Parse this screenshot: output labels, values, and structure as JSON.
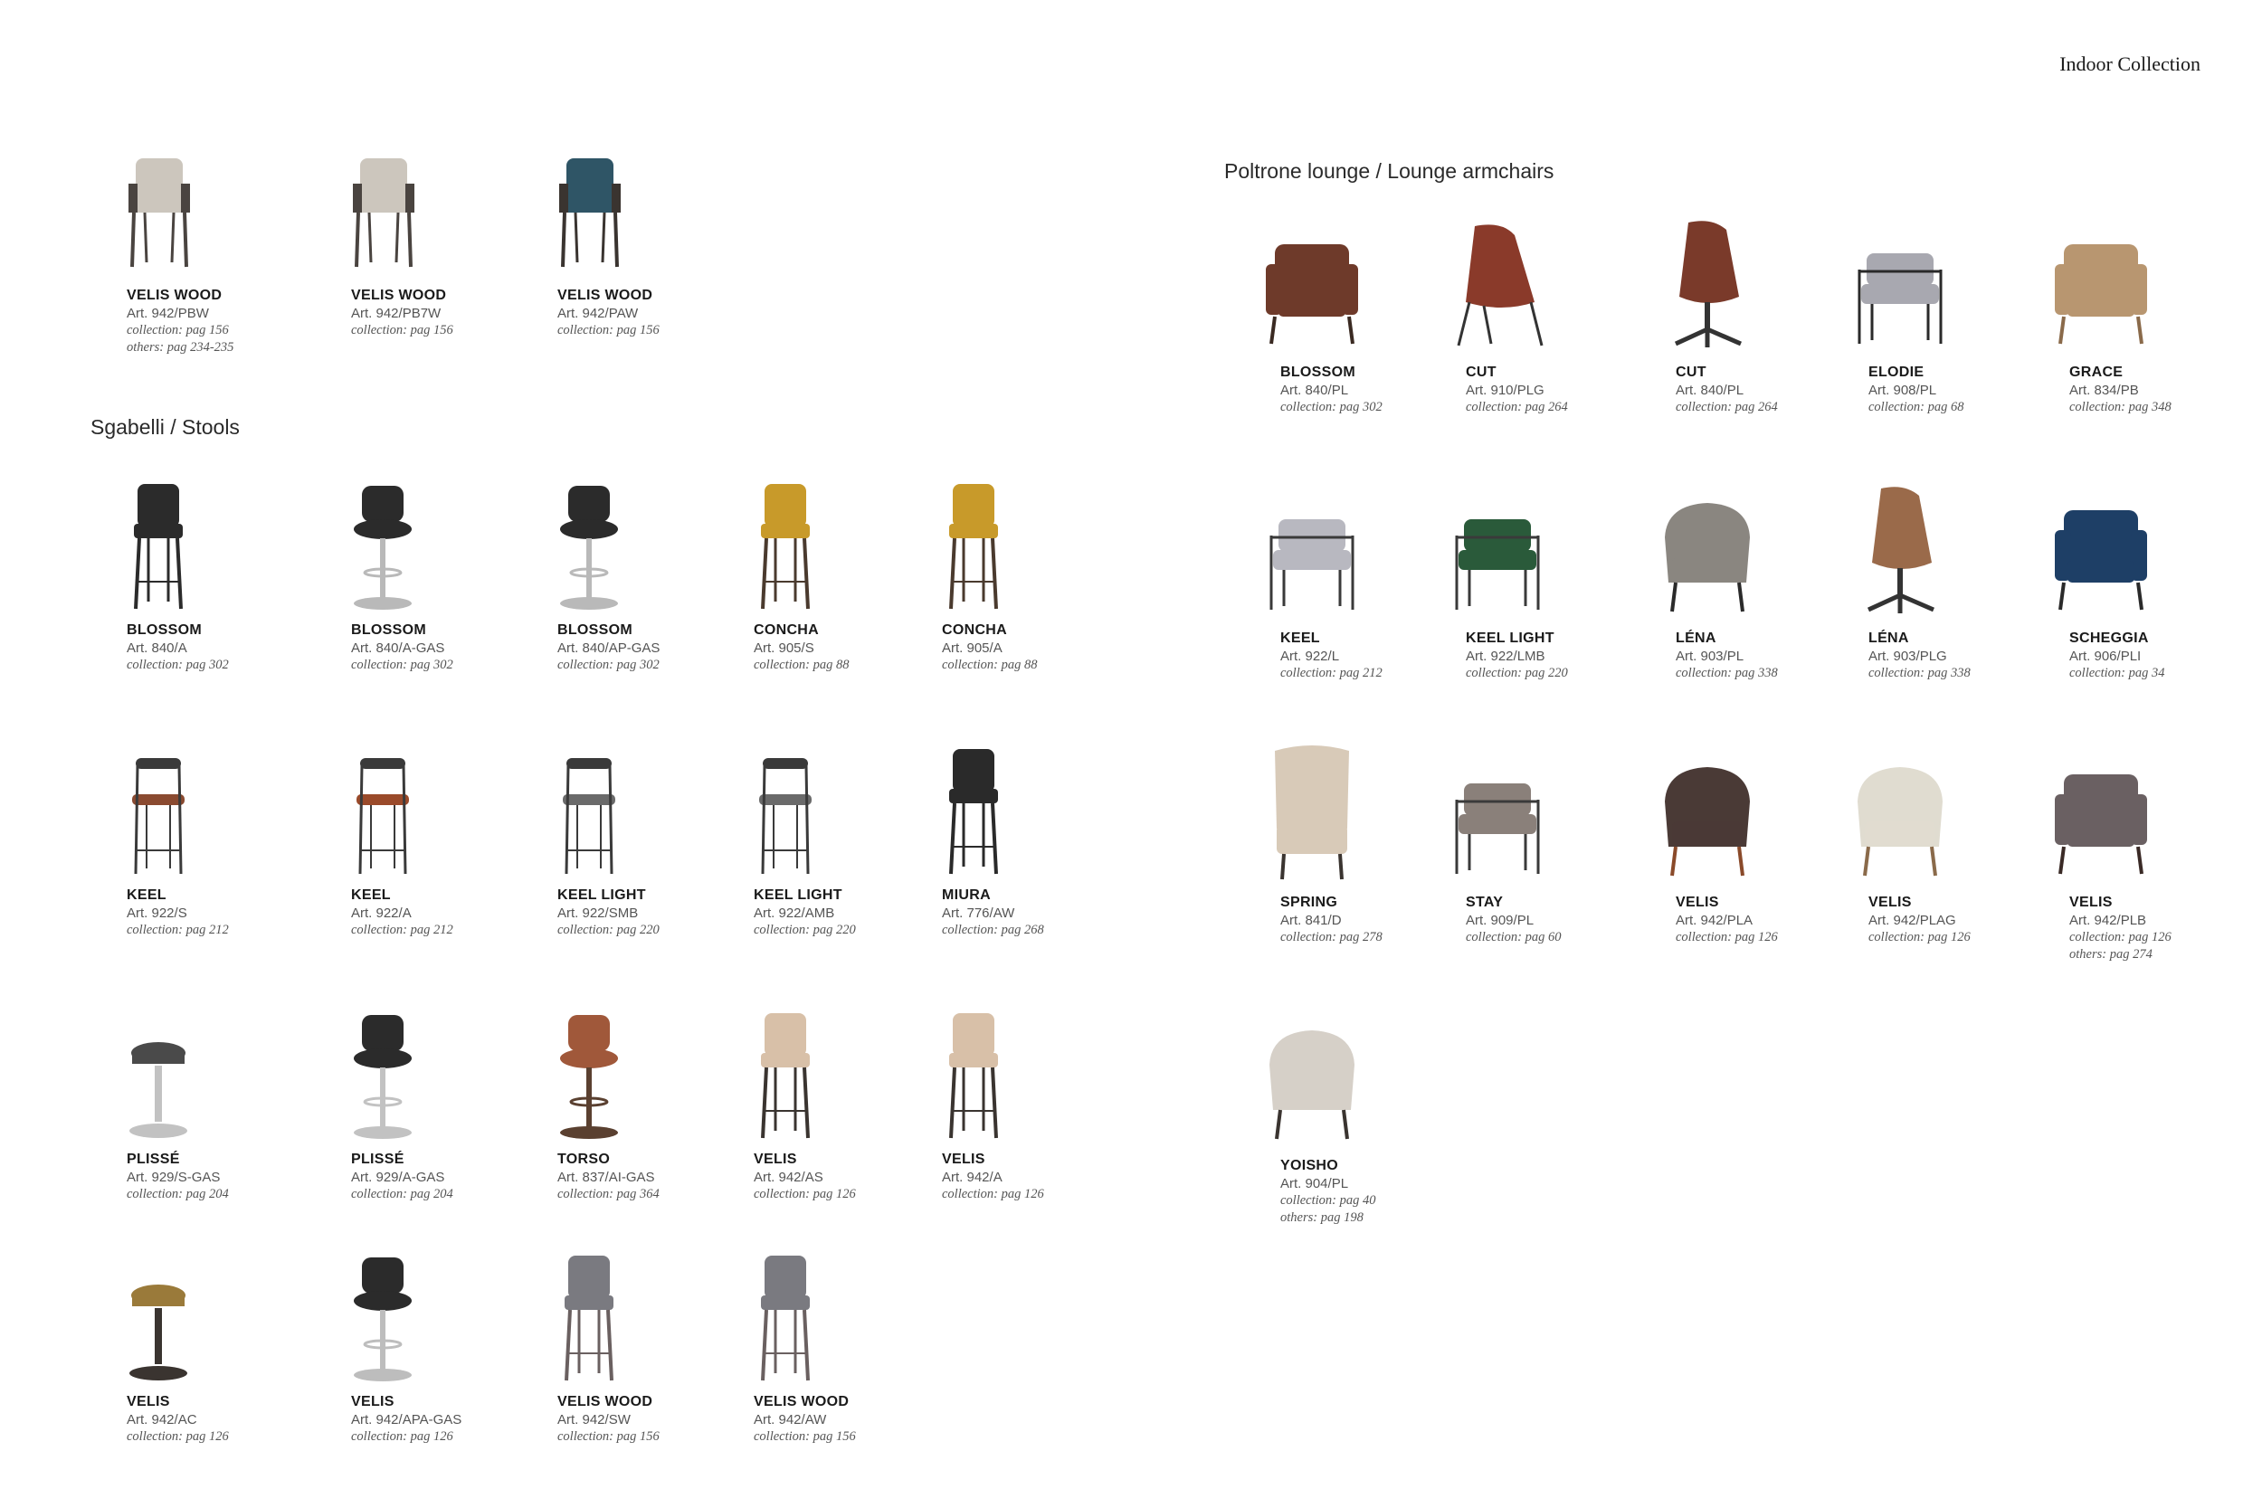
{
  "header": {
    "title": "Indoor Collection"
  },
  "sections": {
    "stools": "Sgabelli / Stools",
    "lounge": "Poltrone lounge / Lounge armchairs"
  },
  "items": [
    {
      "name": "VELIS WOOD",
      "art": "Art. 942/PBW",
      "collection": "collection: pag 156",
      "others": "others: pag 234-235",
      "icon": "armchair-icon",
      "seat": "#ccc6bd",
      "frame": "#4a4440"
    },
    {
      "name": "VELIS WOOD",
      "art": "Art. 942/PB7W",
      "collection": "collection: pag 156",
      "icon": "armchair-icon",
      "seat": "#ccc6bd",
      "frame": "#4a4440"
    },
    {
      "name": "VELIS WOOD",
      "art": "Art. 942/PAW",
      "collection": "collection: pag 156",
      "icon": "armchair-icon",
      "seat": "#2f5566",
      "frame": "#3a3430"
    },
    {
      "name": "BLOSSOM",
      "art": "Art. 840/A",
      "collection": "collection: pag 302",
      "icon": "bar-stool-icon",
      "seat": "#2b2b2b",
      "frame": "#2b2b2b"
    },
    {
      "name": "BLOSSOM",
      "art": "Art. 840/A-GAS",
      "collection": "collection: pag 302",
      "icon": "gas-stool-icon",
      "seat": "#2b2b2b",
      "frame": "#b9b9b9"
    },
    {
      "name": "BLOSSOM",
      "art": "Art. 840/AP-GAS",
      "collection": "collection: pag 302",
      "icon": "gas-stool-icon",
      "seat": "#2b2b2b",
      "frame": "#b9b9b9"
    },
    {
      "name": "CONCHA",
      "art": "Art. 905/S",
      "collection": "collection: pag 88",
      "icon": "bar-stool-icon",
      "seat": "#c89a2a",
      "frame": "#4a3a2e"
    },
    {
      "name": "CONCHA",
      "art": "Art. 905/A",
      "collection": "collection: pag 88",
      "icon": "bar-stool-icon",
      "seat": "#c89a2a",
      "frame": "#4a3a2e"
    },
    {
      "name": "KEEL",
      "art": "Art. 922/S",
      "collection": "collection: pag 212",
      "icon": "metal-stool-icon",
      "seat": "#8a4a30",
      "frame": "#3a3a3a"
    },
    {
      "name": "KEEL",
      "art": "Art. 922/A",
      "collection": "collection: pag 212",
      "icon": "metal-stool-icon",
      "seat": "#9a4a2a",
      "frame": "#3a3a3a"
    },
    {
      "name": "KEEL LIGHT",
      "art": "Art. 922/SMB",
      "collection": "collection: pag 220",
      "icon": "metal-stool-icon",
      "seat": "#6a6a6a",
      "frame": "#3a3a3a"
    },
    {
      "name": "KEEL LIGHT",
      "art": "Art. 922/AMB",
      "collection": "collection: pag 220",
      "icon": "metal-stool-icon",
      "seat": "#6a6a6a",
      "frame": "#3a3a3a"
    },
    {
      "name": "MIURA",
      "art": "Art. 776/AW",
      "collection": "collection: pag 268",
      "icon": "bar-stool-icon",
      "seat": "#2a2a2a",
      "frame": "#2a2a2a"
    },
    {
      "name": "PLISSÉ",
      "art": "Art. 929/S-GAS",
      "collection": "collection: pag 204",
      "icon": "round-stool-icon",
      "seat": "#4a4a4a",
      "frame": "#c2c2c2"
    },
    {
      "name": "PLISSÉ",
      "art": "Art. 929/A-GAS",
      "collection": "collection: pag 204",
      "icon": "gas-stool-icon",
      "seat": "#2b2b2b",
      "frame": "#c2c2c2"
    },
    {
      "name": "TORSO",
      "art": "Art. 837/AI-GAS",
      "collection": "collection: pag 364",
      "icon": "gas-stool-icon",
      "seat": "#a0583a",
      "frame": "#5a4030"
    },
    {
      "name": "VELIS",
      "art": "Art. 942/AS",
      "collection": "collection: pag 126",
      "icon": "bar-stool-icon",
      "seat": "#d8c0a8",
      "frame": "#3a3430"
    },
    {
      "name": "VELIS",
      "art": "Art. 942/A",
      "collection": "collection: pag 126",
      "icon": "bar-stool-icon",
      "seat": "#d8c0a8",
      "frame": "#3a3430"
    },
    {
      "name": "VELIS",
      "art": "Art. 942/AC",
      "collection": "collection: pag 126",
      "icon": "round-stool-icon",
      "seat": "#9a7a3a",
      "frame": "#3a3430"
    },
    {
      "name": "VELIS",
      "art": "Art. 942/APA-GAS",
      "collection": "collection: pag 126",
      "icon": "gas-stool-icon",
      "seat": "#2b2b2b",
      "frame": "#bdbdbd"
    },
    {
      "name": "VELIS WOOD",
      "art": "Art. 942/SW",
      "collection": "collection: pag 156",
      "icon": "bar-stool-icon",
      "seat": "#7a7a80",
      "frame": "#6a6060"
    },
    {
      "name": "VELIS WOOD",
      "art": "Art. 942/AW",
      "collection": "collection: pag 156",
      "icon": "bar-stool-icon",
      "seat": "#7a7a80",
      "frame": "#6a6060"
    },
    {
      "name": "BLOSSOM",
      "art": "Art. 840/PL",
      "collection": "collection: pag 302",
      "icon": "lounge-chair-icon",
      "seat": "#6e3a2a",
      "frame": "#3a2a22"
    },
    {
      "name": "CUT",
      "art": "Art. 910/PLG",
      "collection": "collection: pag 264",
      "icon": "shell-chair-icon",
      "seat": "#8a3a2a",
      "frame": "#333333"
    },
    {
      "name": "CUT",
      "art": "Art. 840/PL",
      "collection": "collection: pag 264",
      "icon": "swivel-chair-icon",
      "seat": "#7a3a2a",
      "frame": "#333333"
    },
    {
      "name": "ELODIE",
      "art": "Art. 908/PL",
      "collection": "collection: pag 68",
      "icon": "frame-armchair-icon",
      "seat": "#a8a8b0",
      "frame": "#2a2a2a"
    },
    {
      "name": "GRACE",
      "art": "Art. 834/PB",
      "collection": "collection: pag 348",
      "icon": "lounge-chair-icon",
      "seat": "#b89670",
      "frame": "#8a6a4a"
    },
    {
      "name": "KEEL",
      "art": "Art. 922/L",
      "collection": "collection: pag 212",
      "icon": "frame-armchair-icon",
      "seat": "#b8b8c0",
      "frame": "#3a3a3a"
    },
    {
      "name": "KEEL LIGHT",
      "art": "Art. 922/LMB",
      "collection": "collection: pag 220",
      "icon": "frame-armchair-icon",
      "seat": "#2a5a3a",
      "frame": "#3a3a3a"
    },
    {
      "name": "LÉNA",
      "art": "Art. 903/PL",
      "collection": "collection: pag 338",
      "icon": "tub-chair-icon",
      "seat": "#8a8680",
      "frame": "#2a2a2a"
    },
    {
      "name": "LÉNA",
      "art": "Art. 903/PLG",
      "collection": "collection: pag 338",
      "icon": "swivel-chair-icon",
      "seat": "#9a6a4a",
      "frame": "#333333"
    },
    {
      "name": "SCHEGGIA",
      "art": "Art. 906/PLI",
      "collection": "collection: pag 34",
      "icon": "lounge-chair-icon",
      "seat": "#1e3f66",
      "frame": "#2a2a2a"
    },
    {
      "name": "SPRING",
      "art": "Art. 841/D",
      "collection": "collection: pag 278",
      "icon": "wingback-chair-icon",
      "seat": "#d8cab8",
      "frame": "#3a3430"
    },
    {
      "name": "STAY",
      "art": "Art. 909/PL",
      "collection": "collection: pag 60",
      "icon": "frame-armchair-icon",
      "seat": "#8a807a",
      "frame": "#3a3a3a"
    },
    {
      "name": "VELIS",
      "art": "Art. 942/PLA",
      "collection": "collection: pag 126",
      "icon": "tub-chair-icon",
      "seat": "#4a3a36",
      "frame": "#8a4a2a"
    },
    {
      "name": "VELIS",
      "art": "Art. 942/PLAG",
      "collection": "collection: pag 126",
      "icon": "tub-chair-icon",
      "seat": "#e0dcd0",
      "frame": "#8a6a4a"
    },
    {
      "name": "VELIS",
      "art": "Art. 942/PLB",
      "collection": "collection: pag 126",
      "others": "others: pag 274",
      "icon": "lounge-chair-icon",
      "seat": "#6a6062",
      "frame": "#3a2a26"
    },
    {
      "name": "YOISHO",
      "art": "Art. 904/PL",
      "collection": "collection: pag 40",
      "others": "others: pag 198",
      "icon": "tub-chair-icon",
      "seat": "#d6d0c8",
      "frame": "#3a3430"
    }
  ]
}
